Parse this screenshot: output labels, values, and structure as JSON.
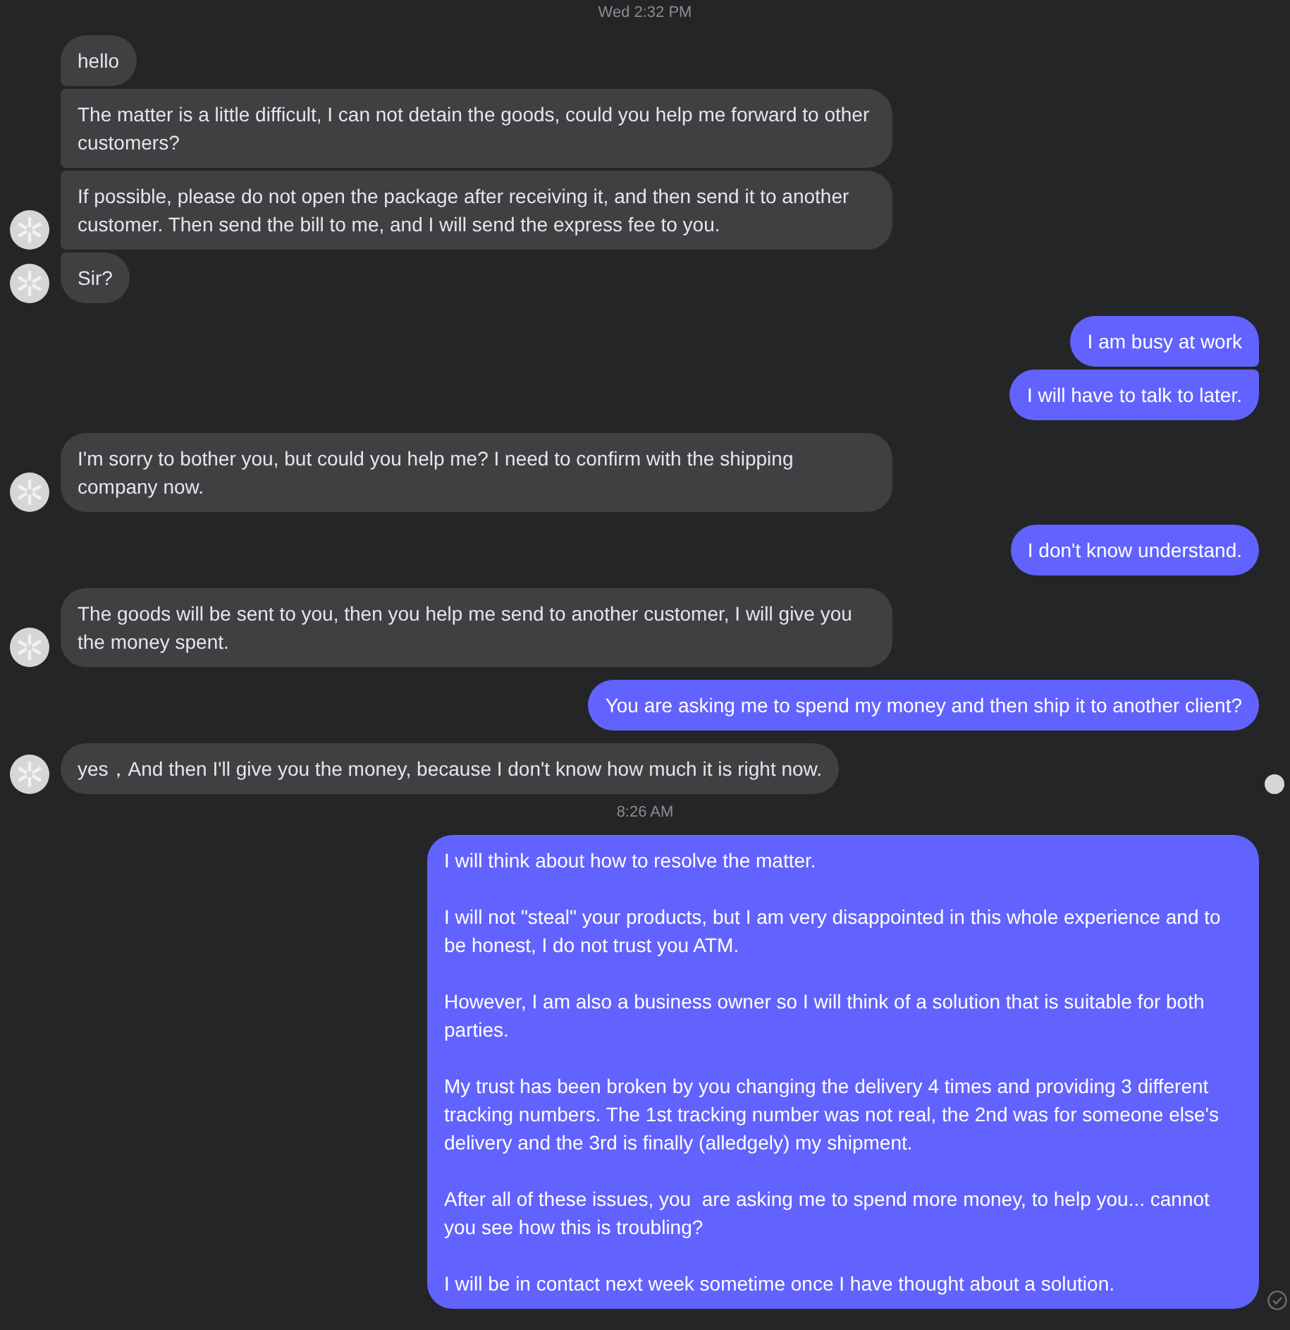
{
  "messages": [
    {
      "kind": "timestamp",
      "text": "Wed 2:32 PM"
    },
    {
      "kind": "incoming",
      "avatar": false,
      "seen_marker": false,
      "paragraphs": [
        "hello"
      ]
    },
    {
      "kind": "incoming",
      "avatar": false,
      "seen_marker": false,
      "paragraphs": [
        "The matter is a little difficult, I can not detain the goods, could you help me forward to other customers?"
      ]
    },
    {
      "kind": "incoming",
      "avatar": true,
      "seen_marker": false,
      "paragraphs": [
        "If possible, please do not open the package after receiving it, and then send it to another customer. Then send the bill to me, and I will send the express fee to you."
      ]
    },
    {
      "kind": "incoming",
      "avatar": true,
      "seen_marker": false,
      "paragraphs": [
        "Sir?"
      ]
    },
    {
      "kind": "outgoing",
      "delivered": false,
      "paragraphs": [
        "I am busy at work"
      ]
    },
    {
      "kind": "outgoing",
      "delivered": false,
      "paragraphs": [
        "I will have to talk to later."
      ]
    },
    {
      "kind": "incoming",
      "avatar": true,
      "seen_marker": false,
      "paragraphs": [
        "I'm sorry to bother you, but could you help me? I need to confirm with the shipping company now."
      ]
    },
    {
      "kind": "outgoing",
      "delivered": false,
      "paragraphs": [
        "I don't know understand."
      ]
    },
    {
      "kind": "incoming",
      "avatar": true,
      "seen_marker": false,
      "paragraphs": [
        "The goods will be sent to you, then you help me send to another customer, I will give you the money spent."
      ]
    },
    {
      "kind": "outgoing",
      "delivered": false,
      "paragraphs": [
        "You are asking me to spend my money and then ship it to another client?"
      ]
    },
    {
      "kind": "incoming",
      "avatar": true,
      "seen_marker": true,
      "paragraphs": [
        "yes，And then I'll give you the money, because I don't know how much it is right now."
      ]
    },
    {
      "kind": "timestamp",
      "text": "8:26 AM"
    },
    {
      "kind": "outgoing",
      "delivered": true,
      "paragraphs": [
        "I will think about how to resolve the matter.",
        "I will not \"steal\" your products, but I am very disappointed in this whole experience and to be honest, I do not trust you ATM.",
        "However, I am also a business owner so I will think of a solution that is suitable for both parties.",
        "My trust has been broken by you changing the delivery 4 times and providing 3 different tracking numbers. The 1st tracking number was not real, the 2nd was for someone else's delivery and the 3rd is finally (alledgely) my shipment.",
        "After all of these issues, you  are asking me to spend more money, to help you... cannot you see how this is troubling?",
        "I will be in contact next week sometime once I have thought about a solution."
      ]
    }
  ]
}
